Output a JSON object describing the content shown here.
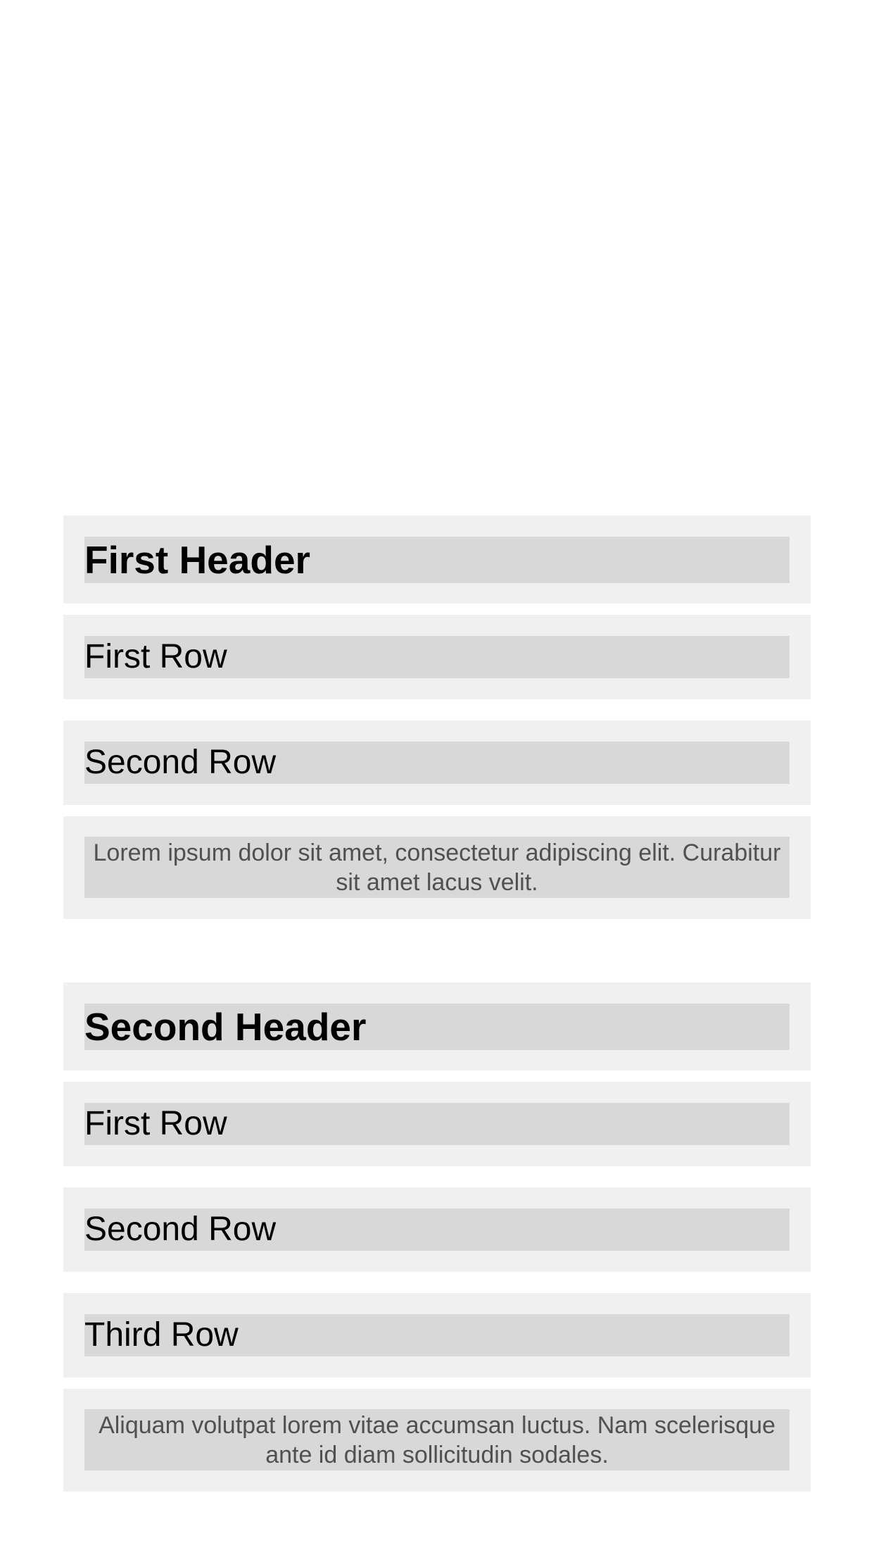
{
  "sections": [
    {
      "header": "First Header",
      "rows": [
        "First Row",
        "Second Row"
      ],
      "footer": "Lorem ipsum dolor sit amet, consectetur adipiscing elit. Curabitur sit amet lacus velit."
    },
    {
      "header": "Second Header",
      "rows": [
        "First Row",
        "Second Row",
        "Third Row"
      ],
      "footer": "Aliquam volutpat lorem vitae accumsan luctus. Nam scelerisque ante id diam sollicitudin sodales."
    }
  ],
  "colors": {
    "page_background": "#ffffff",
    "cell_background": "#f0f0f0",
    "label_background": "#d8d8d8",
    "primary_text": "#000000",
    "footer_text": "#505050"
  }
}
